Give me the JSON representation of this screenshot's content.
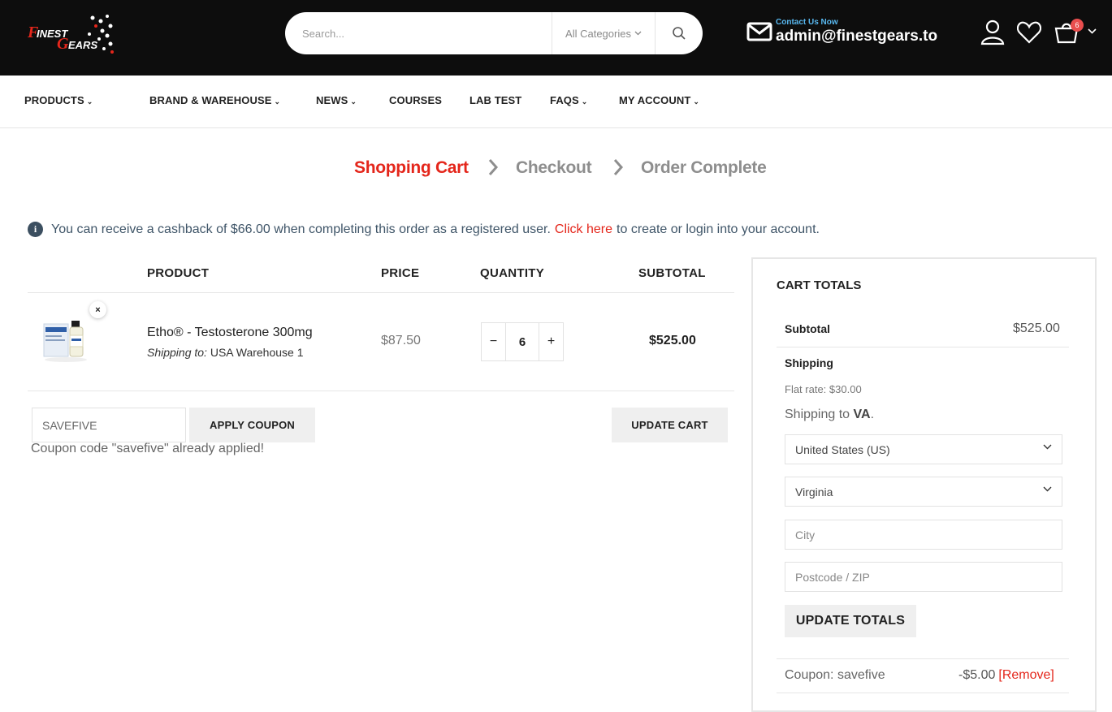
{
  "header": {
    "logo_text": "FinestGears",
    "search": {
      "placeholder": "Search...",
      "category": "All Categories"
    },
    "contact": {
      "label": "Contact Us Now",
      "email": "admin@finestgears.to"
    },
    "cart_count": "6",
    "icons": [
      "mail-icon",
      "user-icon",
      "heart-icon",
      "cart-icon",
      "search-icon"
    ]
  },
  "nav": {
    "items": [
      {
        "label": "PRODUCTS",
        "has_dropdown": true
      },
      {
        "label": "BRAND & WAREHOUSE",
        "has_dropdown": true
      },
      {
        "label": "NEWS",
        "has_dropdown": true
      },
      {
        "label": "COURSES",
        "has_dropdown": false
      },
      {
        "label": "LAB TEST",
        "has_dropdown": false
      },
      {
        "label": "FAQS",
        "has_dropdown": true
      },
      {
        "label": "MY ACCOUNT",
        "has_dropdown": true
      }
    ]
  },
  "steps": {
    "s1": "Shopping Cart",
    "s2": "Checkout",
    "s3": "Order Complete"
  },
  "notice": {
    "before": "You can receive a cashback of $66.00 when completing this order as a registered user.",
    "link": "Click here",
    "after": "to create or login into your account."
  },
  "table": {
    "headers": {
      "product": "PRODUCT",
      "price": "PRICE",
      "quantity": "QUANTITY",
      "subtotal": "SUBTOTAL"
    },
    "item": {
      "name": "Etho® - Testosterone 300mg",
      "shipping_label": "Shipping to:",
      "shipping_value": "USA Warehouse 1",
      "price": "$87.50",
      "quantity": "6",
      "subtotal": "$525.00",
      "remove_symbol": "×"
    }
  },
  "coupon": {
    "value": "SAVEFIVE",
    "apply_label": "APPLY COUPON",
    "update_label": "UPDATE CART",
    "message": "Coupon code \"savefive\" already applied!"
  },
  "totals": {
    "title": "CART TOTALS",
    "subtotal_label": "Subtotal",
    "subtotal_value": "$525.00",
    "shipping_label": "Shipping",
    "flat_rate": "Flat rate: $30.00",
    "ship_to_prefix": "Shipping to",
    "ship_to_state": "VA",
    "country": "United States (US)",
    "state": "Virginia",
    "city_placeholder": "City",
    "zip_placeholder": "Postcode / ZIP",
    "update_totals_label": "UPDATE TOTALS",
    "coupon_label": "Coupon: savefive",
    "coupon_value": "-$5.00",
    "coupon_remove": "[Remove]"
  },
  "colors": {
    "accent_red": "#e4261b",
    "header_bg": "#0d0d0d",
    "contact_blue": "#58b8f0"
  }
}
